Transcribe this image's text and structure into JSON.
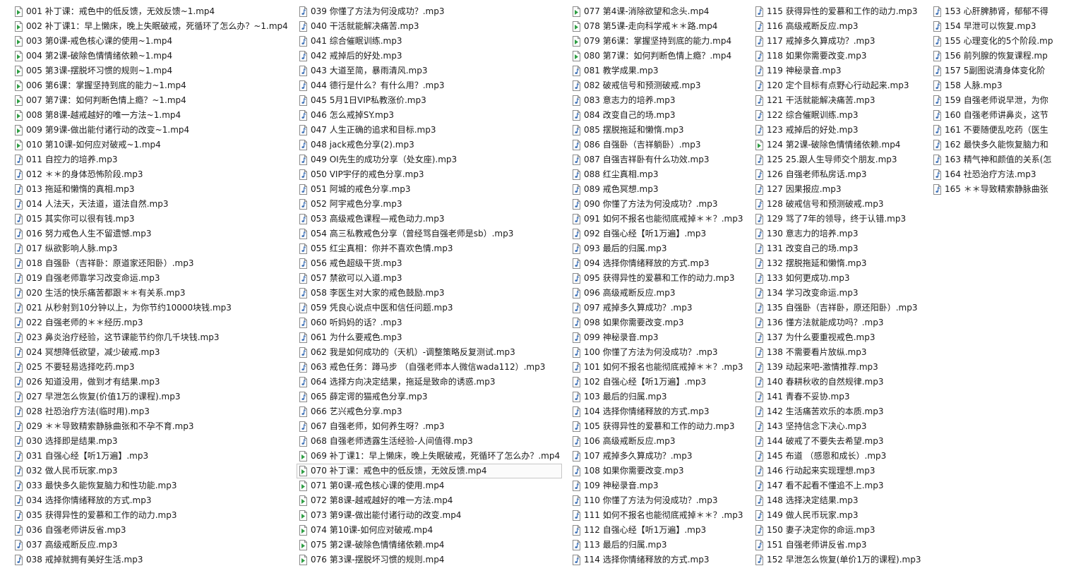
{
  "icons": {
    "video": "video-file-icon",
    "audio": "audio-file-icon"
  },
  "columns": [
    {
      "files": [
        {
          "name": "001 补丁课：戒色中的低反馈，无效反馈~1.mp4",
          "type": "video"
        },
        {
          "name": "002 补丁课1：早上懒床，晚上失眠破戒，死循环了怎么办？~1.mp4",
          "type": "video"
        },
        {
          "name": "003 第0课-戒色核心课的使用~1.mp4",
          "type": "video"
        },
        {
          "name": "004 第2课-破除色情情绪依赖~1.mp4",
          "type": "video"
        },
        {
          "name": "005 第3课-摆脱坏习惯的规则~1.mp4",
          "type": "video"
        },
        {
          "name": "006 第6课：掌握坚持到底的能力~1.mp4",
          "type": "video"
        },
        {
          "name": "007 第7课：如何判断色情上瘾？~1.mp4",
          "type": "video"
        },
        {
          "name": "008 第8课-越戒越好的唯一方法~1.mp4",
          "type": "video"
        },
        {
          "name": "009 第9课-做出能付诸行动的改变~1.mp4",
          "type": "video"
        },
        {
          "name": "010 第10课-如何应对破戒~1.mp4",
          "type": "video"
        },
        {
          "name": "011 自控力的培养.mp3",
          "type": "audio"
        },
        {
          "name": "012 ＊＊的身体恐怖阶段.mp3",
          "type": "audio"
        },
        {
          "name": "013 拖延和懒惰的真相.mp3",
          "type": "audio"
        },
        {
          "name": "014 人法天，天法道，道法自然.mp3",
          "type": "audio"
        },
        {
          "name": "015 其实你可以很有钱.mp3",
          "type": "audio"
        },
        {
          "name": "016 努力戒色人生不留遗憾.mp3",
          "type": "audio"
        },
        {
          "name": "017 纵欲影响人脉.mp3",
          "type": "audio"
        },
        {
          "name": "018 自强卧（吉祥卧：原道家还阳卧）.mp3",
          "type": "audio"
        },
        {
          "name": "019 自强老师靠学习改变命运.mp3",
          "type": "audio"
        },
        {
          "name": "020 生活的快乐痛苦都跟＊＊有关系.mp3",
          "type": "audio"
        },
        {
          "name": "021 从秒射到10分钟以上，为你节约10000块钱.mp3",
          "type": "audio"
        },
        {
          "name": "022 自强老师的＊＊经历.mp3",
          "type": "audio"
        },
        {
          "name": "023 鼻炎治疗经验，这节课能节约你几千块钱.mp3",
          "type": "audio"
        },
        {
          "name": "024 冥想降低欲望，减少破戒.mp3",
          "type": "audio"
        },
        {
          "name": "025 不要轻易选择吃药.mp3",
          "type": "audio"
        },
        {
          "name": "026 知道没用，做到才有结果.mp3",
          "type": "audio"
        },
        {
          "name": "027 早泄怎么恢复(价值1万的课程).mp3",
          "type": "audio"
        },
        {
          "name": "028 社恐治疗方法(临时用).mp3",
          "type": "audio"
        },
        {
          "name": "029 ＊＊导致精索静脉曲张和不孕不育.mp3",
          "type": "audio"
        },
        {
          "name": "030 选择即是结果.mp3",
          "type": "audio"
        },
        {
          "name": "031 自强心经【听1万遍】.mp3",
          "type": "audio"
        },
        {
          "name": "032 做人民币玩家.mp3",
          "type": "audio"
        },
        {
          "name": "033 最快多久能恢复脑力和性功能.mp3",
          "type": "audio"
        },
        {
          "name": "034 选择你情绪释放的方式.mp3",
          "type": "audio"
        },
        {
          "name": "035 获得异性的爱慕和工作的动力.mp3",
          "type": "audio"
        },
        {
          "name": "036 自强老师讲反省.mp3",
          "type": "audio"
        },
        {
          "name": "037 高级戒断反应.mp3",
          "type": "audio"
        },
        {
          "name": "038 戒掉就拥有美好生活.mp3",
          "type": "audio"
        }
      ]
    },
    {
      "files": [
        {
          "name": "039 你懂了方法为何没成功？.mp3",
          "type": "audio"
        },
        {
          "name": "040 干活就能解决痛苦.mp3",
          "type": "audio"
        },
        {
          "name": "041 综合催眠训练.mp3",
          "type": "audio"
        },
        {
          "name": "042 戒掉后的好处.mp3",
          "type": "audio"
        },
        {
          "name": "043 大道至简，暴雨清风.mp3",
          "type": "audio"
        },
        {
          "name": "044 德行是什么？有什么用？.mp3",
          "type": "audio"
        },
        {
          "name": "045 5月1日VIP私教涨价.mp3",
          "type": "audio"
        },
        {
          "name": "046 怎么戒掉SY.mp3",
          "type": "audio"
        },
        {
          "name": "047 人生正确的追求和目标.mp3",
          "type": "audio"
        },
        {
          "name": "048 jack戒色分享(2).mp3",
          "type": "audio"
        },
        {
          "name": "049 OI先生的成功分享（处女座).mp3",
          "type": "audio"
        },
        {
          "name": "050 VIP宇仔的戒色分享.mp3",
          "type": "audio"
        },
        {
          "name": "051 阿城的戒色分享.mp3",
          "type": "audio"
        },
        {
          "name": "052 阿宇戒色分享.mp3",
          "type": "audio"
        },
        {
          "name": "053 高级戒色课程—戒色动力.mp3",
          "type": "audio"
        },
        {
          "name": "054 高三私教戒色分享（曾经骂自强老师是sb）.mp3",
          "type": "audio"
        },
        {
          "name": "055 红尘真相：你并不喜欢色情.mp3",
          "type": "audio"
        },
        {
          "name": "056 戒色超级干货.mp3",
          "type": "audio"
        },
        {
          "name": "057 禁欲可以入道.mp3",
          "type": "audio"
        },
        {
          "name": "058 李医生对大家的戒色鼓励.mp3",
          "type": "audio"
        },
        {
          "name": "059 凭良心说点中医和信任问题.mp3",
          "type": "audio"
        },
        {
          "name": "060 听妈妈的话？.mp3",
          "type": "audio"
        },
        {
          "name": "061 为什么要戒色.mp3",
          "type": "audio"
        },
        {
          "name": "062 我是如何成功的（天机）-调整策略反复测试.mp3",
          "type": "audio"
        },
        {
          "name": "063 戒色任务：蹲马步 （自强老师本人微信wada112）.mp3",
          "type": "audio"
        },
        {
          "name": "064 选择方向决定结果，拖延是致命的诱惑.mp3",
          "type": "audio"
        },
        {
          "name": "065 薛定谔的猫戒色分享.mp3",
          "type": "audio"
        },
        {
          "name": "066 艺兴戒色分享.mp3",
          "type": "audio"
        },
        {
          "name": "067 自强老师，如何养生呀？.mp3",
          "type": "audio"
        },
        {
          "name": "068 自强老师透露生活经验-人间值得.mp3",
          "type": "audio"
        },
        {
          "name": "069 补丁课1：早上懒床，晚上失眠破戒，死循环了怎么办？.mp4",
          "type": "video"
        },
        {
          "name": "070 补丁课：戒色中的低反馈，无效反馈.mp4",
          "type": "video",
          "selected": true
        },
        {
          "name": "071 第0课-戒色核心课的使用.mp4",
          "type": "video"
        },
        {
          "name": "072 第8课-越戒越好的唯一方法.mp4",
          "type": "video"
        },
        {
          "name": "073 第9课-做出能付诸行动的改变.mp4",
          "type": "video"
        },
        {
          "name": "074 第10课-如何应对破戒.mp4",
          "type": "video"
        },
        {
          "name": "075 第2课-破除色情情绪依赖.mp4",
          "type": "video"
        },
        {
          "name": "076 第3课-摆脱坏习惯的规则.mp4",
          "type": "video"
        }
      ]
    },
    {
      "files": [
        {
          "name": "077 第4课-消除欲望和念头.mp4",
          "type": "video"
        },
        {
          "name": "078 第5课-走向科学戒＊＊路.mp4",
          "type": "video"
        },
        {
          "name": "079 第6课：掌握坚持到底的能力.mp4",
          "type": "video"
        },
        {
          "name": "080 第7课：如何判断色情上瘾？.mp4",
          "type": "video"
        },
        {
          "name": "081 教学成果.mp3",
          "type": "audio"
        },
        {
          "name": "082 破戒信号和预测破戒.mp3",
          "type": "audio"
        },
        {
          "name": "083 意志力的培养.mp3",
          "type": "audio"
        },
        {
          "name": "084 改变自己的场.mp3",
          "type": "audio"
        },
        {
          "name": "085 摆脱拖延和懒惰.mp3",
          "type": "audio"
        },
        {
          "name": "086 自强卧（吉祥躺卧）.mp3",
          "type": "audio"
        },
        {
          "name": "087 自强吉祥卧有什么功效.mp3",
          "type": "audio"
        },
        {
          "name": "088 红尘真相.mp3",
          "type": "audio"
        },
        {
          "name": "089 戒色冥想.mp3",
          "type": "audio"
        },
        {
          "name": "090 你懂了方法为何没成功？.mp3",
          "type": "audio"
        },
        {
          "name": "091 如何不报名也能彻底戒掉＊＊？.mp3",
          "type": "audio"
        },
        {
          "name": "092 自强心经【听1万遍】.mp3",
          "type": "audio"
        },
        {
          "name": "093 最后的归属.mp3",
          "type": "audio"
        },
        {
          "name": "094 选择你情绪释放的方式.mp3",
          "type": "audio"
        },
        {
          "name": "095 获得异性的爱慕和工作的动力.mp3",
          "type": "audio"
        },
        {
          "name": "096 高级戒断反应.mp3",
          "type": "audio"
        },
        {
          "name": "097 戒掉多久算成功？.mp3",
          "type": "audio"
        },
        {
          "name": "098 如果你需要改变.mp3",
          "type": "audio"
        },
        {
          "name": "099 神秘录音.mp3",
          "type": "audio"
        },
        {
          "name": "100 你懂了方法为何没成功？.mp3",
          "type": "audio"
        },
        {
          "name": "101 如何不报名也能彻底戒掉＊＊？.mp3",
          "type": "audio"
        },
        {
          "name": "102 自强心经【听1万遍】.mp3",
          "type": "audio"
        },
        {
          "name": "103 最后的归属.mp3",
          "type": "audio"
        },
        {
          "name": "104 选择你情绪释放的方式.mp3",
          "type": "audio"
        },
        {
          "name": "105 获得异性的爱慕和工作的动力.mp3",
          "type": "audio"
        },
        {
          "name": "106 高级戒断反应.mp3",
          "type": "audio"
        },
        {
          "name": "107 戒掉多久算成功？.mp3",
          "type": "audio"
        },
        {
          "name": "108 如果你需要改变.mp3",
          "type": "audio"
        },
        {
          "name": "109 神秘录音.mp3",
          "type": "audio"
        },
        {
          "name": "110 你懂了方法为何没成功？.mp3",
          "type": "audio"
        },
        {
          "name": "111 如何不报名也能彻底戒掉＊＊？.mp3",
          "type": "audio"
        },
        {
          "name": "112 自强心经【听1万遍】.mp3",
          "type": "audio"
        },
        {
          "name": "113 最后的归属.mp3",
          "type": "audio"
        },
        {
          "name": "114 选择你情绪释放的方式.mp3",
          "type": "audio"
        }
      ]
    },
    {
      "files": [
        {
          "name": "115 获得异性的爱慕和工作的动力.mp3",
          "type": "audio"
        },
        {
          "name": "116 高级戒断反应.mp3",
          "type": "audio"
        },
        {
          "name": "117 戒掉多久算成功？.mp3",
          "type": "audio"
        },
        {
          "name": "118 如果你需要改变.mp3",
          "type": "audio"
        },
        {
          "name": "119 神秘录音.mp3",
          "type": "audio"
        },
        {
          "name": "120 定个目标有点野心行动起来.mp3",
          "type": "audio"
        },
        {
          "name": "121 干活就能解决痛苦.mp3",
          "type": "audio"
        },
        {
          "name": "122 综合催眠训练.mp3",
          "type": "audio"
        },
        {
          "name": "123 戒掉后的好处.mp3",
          "type": "audio"
        },
        {
          "name": "124 第2课-破除色情情绪依赖.mp4",
          "type": "video"
        },
        {
          "name": "125 25.跟人生导师交个朋友.mp3",
          "type": "audio"
        },
        {
          "name": "126 自强老师私房话.mp3",
          "type": "audio"
        },
        {
          "name": "127 因果报应.mp3",
          "type": "audio"
        },
        {
          "name": "128 破戒信号和预测破戒.mp3",
          "type": "audio"
        },
        {
          "name": "129 骂了7年的领导，终于认错.mp3",
          "type": "audio"
        },
        {
          "name": "130 意志力的培养.mp3",
          "type": "audio"
        },
        {
          "name": "131 改变自己的场.mp3",
          "type": "audio"
        },
        {
          "name": "132 摆脱拖延和懒惰.mp3",
          "type": "audio"
        },
        {
          "name": "133 如何更成功.mp3",
          "type": "audio"
        },
        {
          "name": "134 学习改变命运.mp3",
          "type": "audio"
        },
        {
          "name": "135 自强卧（吉祥卧，原还阳卧）.mp3",
          "type": "audio"
        },
        {
          "name": "136 懂方法就能成功吗？.mp3",
          "type": "audio"
        },
        {
          "name": "137 为什么要重视戒色.mp3",
          "type": "audio"
        },
        {
          "name": "138 不需要看片放纵.mp3",
          "type": "audio"
        },
        {
          "name": "139 动起来吧-激情推荐.mp3",
          "type": "audio"
        },
        {
          "name": "140 春耕秋收的自然规律.mp3",
          "type": "audio"
        },
        {
          "name": "141 青春不妥协.mp3",
          "type": "audio"
        },
        {
          "name": "142 生活痛苦欢乐的本质.mp3",
          "type": "audio"
        },
        {
          "name": "143 坚持信念下决心.mp3",
          "type": "audio"
        },
        {
          "name": "144 破戒了不要失去希望.mp3",
          "type": "audio"
        },
        {
          "name": "145 布道 （感恩和成长）.mp3",
          "type": "audio"
        },
        {
          "name": "146 行动起来实现理想.mp3",
          "type": "audio"
        },
        {
          "name": "147 看不起看不懂追不上.mp3",
          "type": "audio"
        },
        {
          "name": "148 选择决定结果.mp3",
          "type": "audio"
        },
        {
          "name": "149 做人民币玩家.mp3",
          "type": "audio"
        },
        {
          "name": "150 妻子决定你的命运.mp3",
          "type": "audio"
        },
        {
          "name": "151 自强老师讲反省.mp3",
          "type": "audio"
        },
        {
          "name": "152 早泄怎么恢复(单价1万的课程).mp3",
          "type": "audio"
        }
      ]
    },
    {
      "files": [
        {
          "name": "153 心肝脾肺肾，郁郁不得",
          "type": "audio"
        },
        {
          "name": "154 早泄可以恢复.mp3",
          "type": "audio"
        },
        {
          "name": "155 心理变化的5个阶段.mp",
          "type": "audio"
        },
        {
          "name": "156 前列腺的恢复课程.mp",
          "type": "audio"
        },
        {
          "name": "157 5副图说清身体变化阶",
          "type": "audio"
        },
        {
          "name": "158 人脉.mp3",
          "type": "audio"
        },
        {
          "name": "159 自强老师说早泄，为你",
          "type": "audio"
        },
        {
          "name": "160 自强老师讲鼻炎，这节",
          "type": "audio"
        },
        {
          "name": "161 不要随便乱吃药（医生",
          "type": "audio"
        },
        {
          "name": "162 最快多久能恢复脑力和",
          "type": "audio"
        },
        {
          "name": "163 精气神和颜值的关系(怎",
          "type": "audio"
        },
        {
          "name": "164 社恐治疗方法.mp3",
          "type": "audio"
        },
        {
          "name": "165 ＊＊导致精索静脉曲张",
          "type": "audio"
        }
      ]
    }
  ]
}
